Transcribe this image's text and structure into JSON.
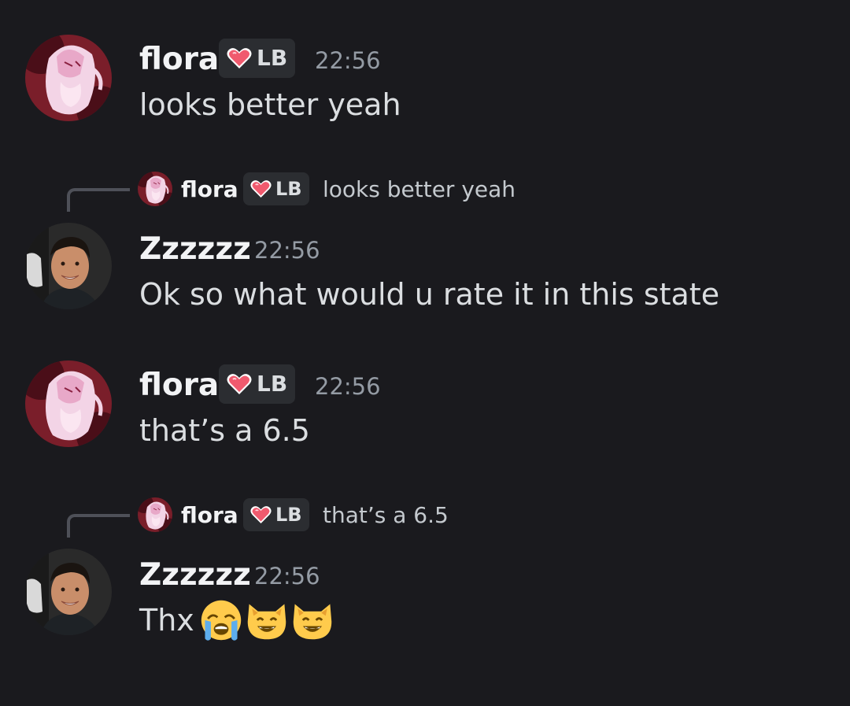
{
  "colors": {
    "background": "#1a1a1e",
    "name": "#f2f3f5",
    "text": "#dbdee1",
    "timestamp": "#949ba4",
    "tag_bg": "#2b2d31",
    "heart": "#f05a6e"
  },
  "messages": [
    {
      "author": "flora",
      "tag": "LB",
      "time": "22:56",
      "text": "looks better yeah",
      "avatar_icon": "anime-avatar-icon"
    },
    {
      "reply": {
        "author": "flora",
        "tag": "LB",
        "text": "looks better yeah"
      },
      "author": "Zzzzzz",
      "time": "22:56",
      "text": "Ok so what would u rate it in this state",
      "avatar_icon": "person-avatar-icon"
    },
    {
      "author": "flora",
      "tag": "LB",
      "time": "22:56",
      "text": "that’s a 6.5",
      "avatar_icon": "anime-avatar-icon"
    },
    {
      "reply": {
        "author": "flora",
        "tag": "LB",
        "text": "that’s a 6.5"
      },
      "author": "Zzzzzz",
      "time": "22:56",
      "text": "Thx",
      "emojis": [
        "crying-face-emoji",
        "grinning-cat-emoji",
        "grinning-cat-emoji"
      ],
      "avatar_icon": "person-avatar-icon"
    }
  ]
}
